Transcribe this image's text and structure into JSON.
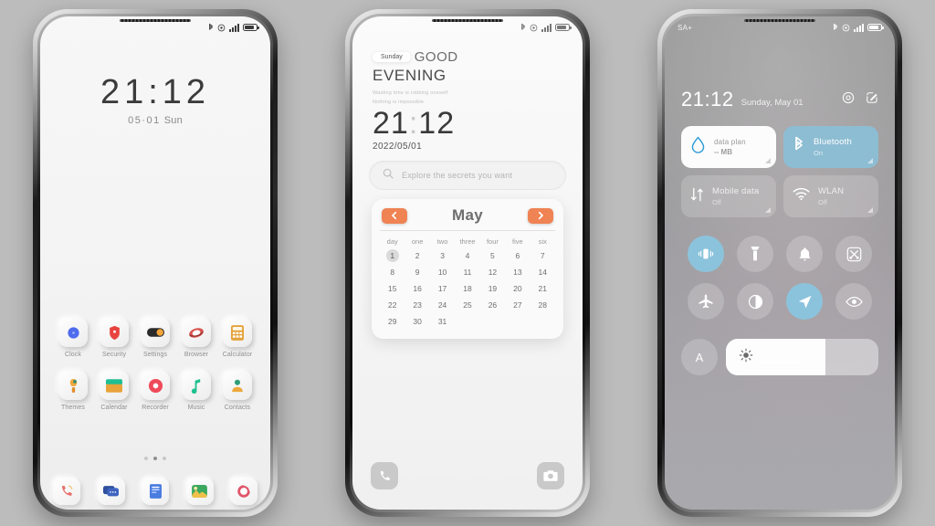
{
  "background_color": "#bcbcbc",
  "phone1": {
    "name": "lock-home-screen",
    "statusbar": {
      "left": "",
      "icons": [
        "bluetooth-icon",
        "alarm-icon",
        "signal-icon",
        "battery-icon"
      ]
    },
    "clock": "21:12",
    "date": "05·01",
    "weekday": "Sun",
    "apps_row1": [
      {
        "label": "Clock",
        "icon": "clock-icon",
        "color": "#4f6bed"
      },
      {
        "label": "Security",
        "icon": "shield-icon",
        "color": "#e8433f"
      },
      {
        "label": "Settings",
        "icon": "settings-toggle-icon",
        "color": "#f3a63a"
      },
      {
        "label": "Browser",
        "icon": "browser-icon",
        "color": "#d9534f"
      },
      {
        "label": "Calculator",
        "icon": "calculator-icon",
        "color": "#e4a33c"
      }
    ],
    "apps_row2": [
      {
        "label": "Themes",
        "icon": "themes-icon",
        "color": "#f0a73c"
      },
      {
        "label": "Calendar",
        "icon": "calendar-icon",
        "color": "#1fbf93"
      },
      {
        "label": "Recorder",
        "icon": "recorder-icon",
        "color": "#ef4a5a"
      },
      {
        "label": "Music",
        "icon": "music-note-icon",
        "color": "#1fc08f"
      },
      {
        "label": "Contacts",
        "icon": "contacts-icon",
        "color": "#eda93c"
      }
    ],
    "page_dots": {
      "count": 3,
      "active_index": 1
    },
    "dock": [
      {
        "name": "phone-dock-icon",
        "color": "#e8706b"
      },
      {
        "name": "messages-dock-icon",
        "color": "#2f4f9e"
      },
      {
        "name": "notes-dock-icon",
        "color": "#4a7de0"
      },
      {
        "name": "gallery-dock-icon",
        "color": "#3ba85f"
      },
      {
        "name": "camera-dock-icon",
        "color": "#e0566b"
      }
    ]
  },
  "phone2": {
    "name": "widget-home-screen",
    "statusbar": {
      "icons": [
        "bluetooth-icon",
        "alarm-icon",
        "signal-icon",
        "battery-icon"
      ]
    },
    "day_chip": "Sunday",
    "greeting_line1": "GOOD",
    "greeting_line2": "EVENING",
    "quote_line1": "Wasting time is robbing oneself",
    "quote_line2": "Nothing is impossible",
    "clock_hours": "21",
    "clock_colon": ":",
    "clock_minutes": "12",
    "date": "2022/05/01",
    "search": {
      "placeholder": "Explore the secrets you want",
      "icon": "search-icon"
    },
    "calendar": {
      "prev_icon": "chevron-left-icon",
      "next_icon": "chevron-right-icon",
      "month": "May",
      "weekdays": [
        "day",
        "one",
        "two",
        "three",
        "four",
        "five",
        "six"
      ],
      "days": [
        1,
        2,
        3,
        4,
        5,
        6,
        7,
        8,
        9,
        10,
        11,
        12,
        13,
        14,
        15,
        16,
        17,
        18,
        19,
        20,
        21,
        22,
        23,
        24,
        25,
        26,
        27,
        28,
        29,
        30,
        31
      ],
      "today": 1
    },
    "bottom_left": {
      "name": "phone-button",
      "icon": "phone-icon"
    },
    "bottom_right": {
      "name": "camera-button",
      "icon": "camera-icon"
    }
  },
  "phone3": {
    "name": "control-center",
    "statusbar": {
      "left": "SA+",
      "icons": [
        "bluetooth-icon",
        "alarm-icon",
        "signal-icon",
        "battery-icon"
      ]
    },
    "time": "21:12",
    "date": "Sunday, May 01",
    "header_actions": [
      {
        "name": "settings-icon"
      },
      {
        "name": "edit-icon"
      }
    ],
    "tiles": [
      {
        "name": "data-plan-tile",
        "title": "data plan",
        "sub": "-- MB",
        "state": "light",
        "icon": "data-drop-icon",
        "accent": "#2d9bd6"
      },
      {
        "name": "bluetooth-tile",
        "title": "Bluetooth",
        "sub": "On",
        "state": "blue",
        "icon": "bluetooth-icon",
        "accent": "#ffffff"
      },
      {
        "name": "mobile-data-tile",
        "title": "Mobile data",
        "sub": "Off",
        "state": "dim",
        "icon": "mobile-data-icon",
        "accent": "#ffffff"
      },
      {
        "name": "wlan-tile",
        "title": "WLAN",
        "sub": "Off",
        "state": "dim",
        "icon": "wifi-icon",
        "accent": "#ffffff"
      }
    ],
    "toggles": [
      {
        "name": "vibrate-toggle",
        "icon": "vibrate-icon",
        "active": true
      },
      {
        "name": "flashlight-toggle",
        "icon": "flashlight-icon",
        "active": false
      },
      {
        "name": "ringer-toggle",
        "icon": "bell-icon",
        "active": false
      },
      {
        "name": "screenshot-toggle",
        "icon": "screenshot-icon",
        "active": false
      },
      {
        "name": "airplane-toggle",
        "icon": "airplane-icon",
        "active": false
      },
      {
        "name": "dark-mode-toggle",
        "icon": "contrast-icon",
        "active": false
      },
      {
        "name": "location-toggle",
        "icon": "location-arrow-icon",
        "active": true
      },
      {
        "name": "eye-care-toggle",
        "icon": "eye-icon",
        "active": false
      }
    ],
    "brightness": {
      "auto_label": "A",
      "icon": "brightness-sun-icon",
      "percent": 65
    },
    "home_indicator": true,
    "accent_blue": "#8cc3dc"
  }
}
